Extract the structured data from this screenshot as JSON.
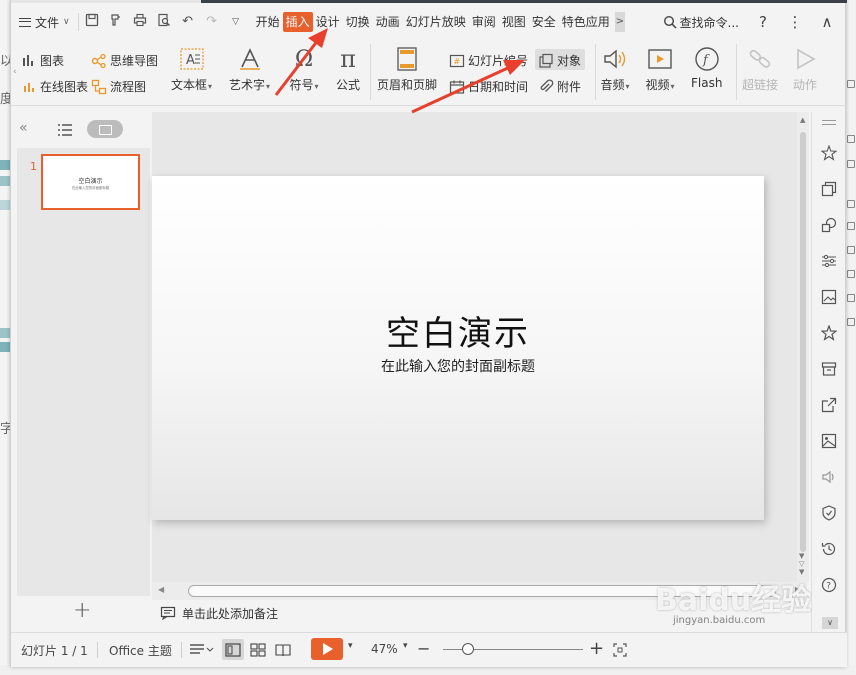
{
  "colors": {
    "accent": "#e8612c",
    "annotation_arrow": "#e8402c"
  },
  "menubar": {
    "file_label": "文件",
    "tabs": [
      {
        "label": "开始",
        "active": false
      },
      {
        "label": "插入",
        "active": true
      },
      {
        "label": "设计",
        "active": false
      },
      {
        "label": "切换",
        "active": false
      },
      {
        "label": "动画",
        "active": false
      },
      {
        "label": "幻灯片放映",
        "active": false
      },
      {
        "label": "审阅",
        "active": false
      },
      {
        "label": "视图",
        "active": false
      },
      {
        "label": "安全",
        "active": false
      },
      {
        "label": "特色应用",
        "active": false
      }
    ],
    "more_glyph": ">",
    "search_label": "查找命令...",
    "help_glyph": "?",
    "kebab_glyph": "⋮",
    "collapse_glyph": "∧"
  },
  "ribbon": {
    "chart": "图表",
    "online_chart": "在线图表",
    "mind_map": "思维导图",
    "flowchart": "流程图",
    "text_box": "文本框",
    "art_text": "艺术字",
    "symbol": "符号",
    "formula": "公式",
    "header_footer": "页眉和页脚",
    "slide_number": "幻灯片编号",
    "date_time": "日期和时间",
    "object": "对象",
    "attachment": "附件",
    "audio": "音频",
    "video": "视频",
    "flash": "Flash",
    "hyperlink": "超链接",
    "action": "动作"
  },
  "thumbnails": {
    "slide_number": "1",
    "thumb_title": "空白演示",
    "thumb_subtitle": "在此输入您的封面副标题",
    "add_glyph": "+"
  },
  "slide": {
    "title": "空白演示",
    "subtitle": "在此输入您的封面副标题"
  },
  "notes": {
    "placeholder": "单击此处添加备注"
  },
  "statusbar": {
    "slide_counter": "幻灯片 1 / 1",
    "theme": "Office 主题",
    "zoom": "47%",
    "zoom_minus": "−",
    "zoom_plus": "+"
  },
  "watermark": {
    "brand": "Baidu经验",
    "sub": "jingyan.baidu.com"
  },
  "background": {
    "left_chars": [
      "以",
      "度",
      "字"
    ]
  }
}
